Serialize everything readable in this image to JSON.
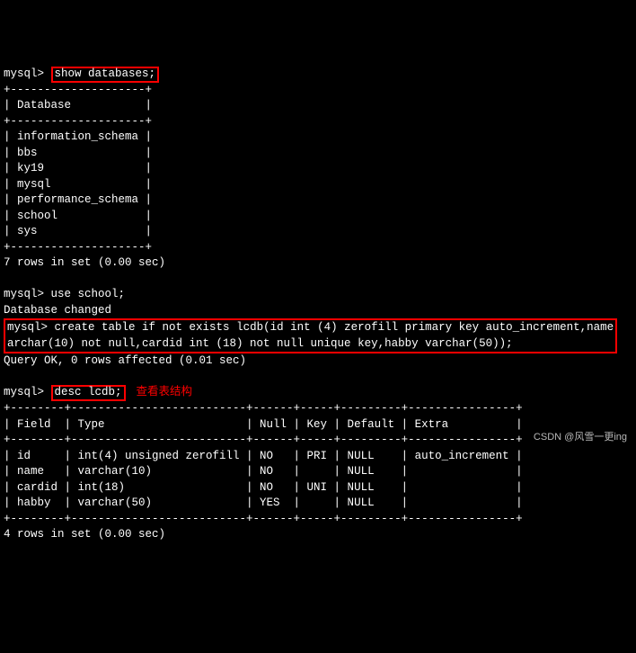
{
  "prompt": "mysql>",
  "cmd1": "show databases;",
  "table_sep": "+--------------------+",
  "db_header": "| Database           |",
  "db_rows": [
    "| information_schema |",
    "| bbs                |",
    "| ky19               |",
    "| mysql              |",
    "| performance_schema |",
    "| school             |",
    "| sys                |"
  ],
  "result1": "7 rows in set (0.00 sec)",
  "cmd2": "use school;",
  "changed": "Database changed",
  "cmd3a": "create table if not exists lcdb(id int (4) zerofill primary key auto_increment,name",
  "cmd3b": "archar(10) not null,cardid int (18) not null unique key,habby varchar(50));",
  "result2": "Query OK, 0 rows affected (0.01 sec)",
  "cmd4": "desc lcdb;",
  "annotation": "查看表结构",
  "desc_sep": "+--------+--------------------------+------+-----+---------+----------------+",
  "desc_header": "| Field  | Type                     | Null | Key | Default | Extra          |",
  "desc_rows": [
    "| id     | int(4) unsigned zerofill | NO   | PRI | NULL    | auto_increment |",
    "| name   | varchar(10)              | NO   |     | NULL    |                |",
    "| cardid | int(18)                  | NO   | UNI | NULL    |                |",
    "| habby  | varchar(50)              | YES  |     | NULL    |                |"
  ],
  "result3": "4 rows in set (0.00 sec)",
  "watermark": "CSDN @风雪一更ing",
  "chart_data": {
    "type": "table",
    "databases": [
      "information_schema",
      "bbs",
      "ky19",
      "mysql",
      "performance_schema",
      "school",
      "sys"
    ],
    "describe_lcdb": {
      "columns": [
        "Field",
        "Type",
        "Null",
        "Key",
        "Default",
        "Extra"
      ],
      "rows": [
        [
          "id",
          "int(4) unsigned zerofill",
          "NO",
          "PRI",
          "NULL",
          "auto_increment"
        ],
        [
          "name",
          "varchar(10)",
          "NO",
          "",
          "NULL",
          ""
        ],
        [
          "cardid",
          "int(18)",
          "NO",
          "UNI",
          "NULL",
          ""
        ],
        [
          "habby",
          "varchar(50)",
          "YES",
          "",
          "NULL",
          ""
        ]
      ]
    }
  }
}
